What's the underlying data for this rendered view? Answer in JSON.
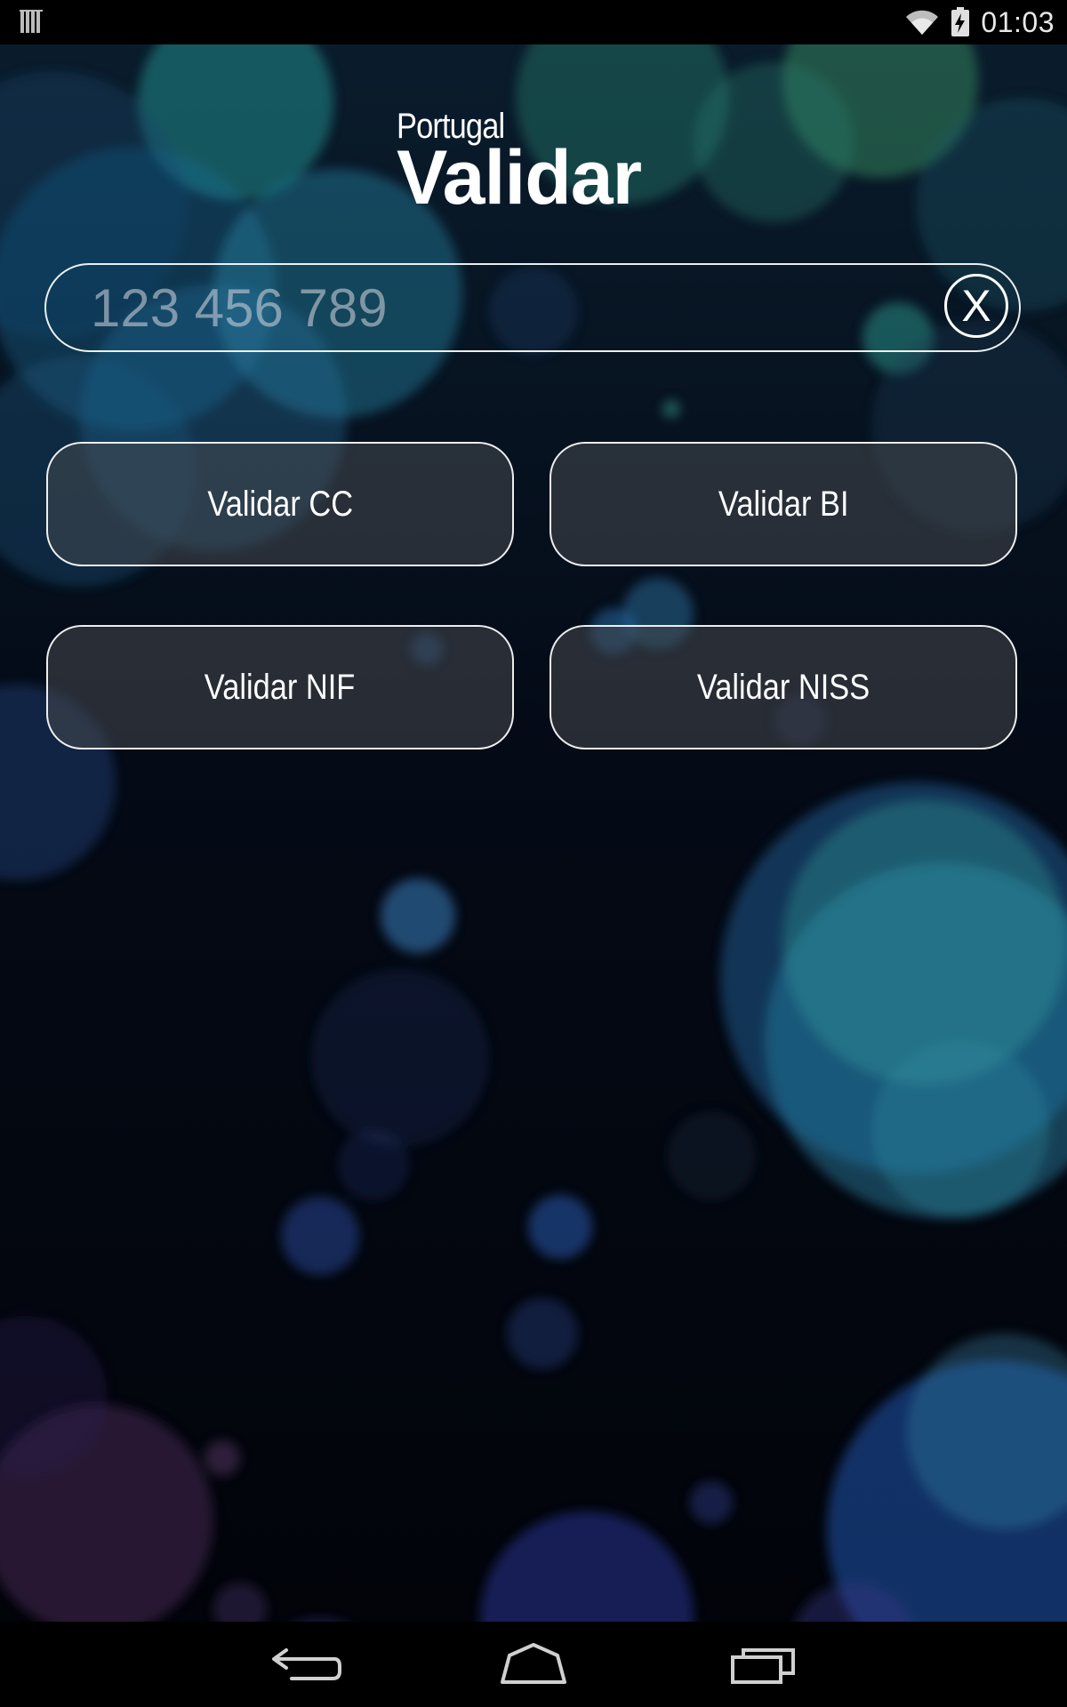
{
  "status_bar": {
    "time": "01:03",
    "icons": [
      "notification-icon",
      "wifi-icon",
      "battery-charging-icon"
    ]
  },
  "logo": {
    "subtitle": "Portugal",
    "title": "Validar"
  },
  "search": {
    "placeholder": "123 456 789",
    "value": "",
    "clear_label": "X"
  },
  "buttons": {
    "cc": "Validar CC",
    "bi": "Validar BI",
    "nif": "Validar NIF",
    "niss": "Validar NISS"
  },
  "nav": {
    "icons": [
      "back-icon",
      "home-icon",
      "recent-apps-icon"
    ]
  },
  "colors": {
    "background": "#03060f",
    "text": "#ffffff",
    "button_fill": "#46484e"
  }
}
